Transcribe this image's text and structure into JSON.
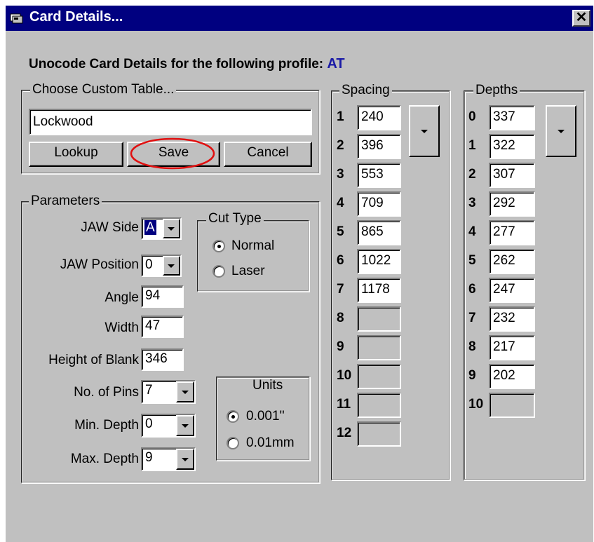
{
  "window": {
    "title": "Card Details..."
  },
  "heading": {
    "text": "Unocode Card Details for the following profile:",
    "profile": "AT"
  },
  "custom_table": {
    "legend": "Choose Custom Table...",
    "value": "Lockwood",
    "lookup_label": "Lookup",
    "save_label": "Save",
    "cancel_label": "Cancel"
  },
  "parameters": {
    "legend": "Parameters",
    "jaw_side_label": "JAW Side",
    "jaw_side_value": "A",
    "jaw_position_label": "JAW Position",
    "jaw_position_value": "0",
    "angle_label": "Angle",
    "angle_value": "94",
    "width_label": "Width",
    "width_value": "47",
    "height_label": "Height of Blank",
    "height_value": "346",
    "pins_label": "No. of Pins",
    "pins_value": "7",
    "min_depth_label": "Min. Depth",
    "min_depth_value": "0",
    "max_depth_label": "Max. Depth",
    "max_depth_value": "9"
  },
  "cut_type": {
    "legend": "Cut Type",
    "normal": "Normal",
    "laser": "Laser",
    "selected": "Normal"
  },
  "units": {
    "legend": "Units",
    "inch": "0.001''",
    "mm": "0.01mm",
    "selected": "0.001''"
  },
  "spacing": {
    "legend": "Spacing",
    "rows": [
      {
        "n": "1",
        "v": "240"
      },
      {
        "n": "2",
        "v": "396"
      },
      {
        "n": "3",
        "v": "553"
      },
      {
        "n": "4",
        "v": "709"
      },
      {
        "n": "5",
        "v": "865"
      },
      {
        "n": "6",
        "v": "1022"
      },
      {
        "n": "7",
        "v": "1178"
      },
      {
        "n": "8",
        "v": ""
      },
      {
        "n": "9",
        "v": ""
      },
      {
        "n": "10",
        "v": ""
      },
      {
        "n": "11",
        "v": ""
      },
      {
        "n": "12",
        "v": ""
      }
    ]
  },
  "depths": {
    "legend": "Depths",
    "rows": [
      {
        "n": "0",
        "v": "337"
      },
      {
        "n": "1",
        "v": "322"
      },
      {
        "n": "2",
        "v": "307"
      },
      {
        "n": "3",
        "v": "292"
      },
      {
        "n": "4",
        "v": "277"
      },
      {
        "n": "5",
        "v": "262"
      },
      {
        "n": "6",
        "v": "247"
      },
      {
        "n": "7",
        "v": "232"
      },
      {
        "n": "8",
        "v": "217"
      },
      {
        "n": "9",
        "v": "202"
      },
      {
        "n": "10",
        "v": ""
      }
    ]
  },
  "colors": {
    "titlebar": "#000080",
    "face": "#c0c0c0",
    "highlight_circle": "#e01010",
    "profile_text": "#1a1aa6"
  }
}
